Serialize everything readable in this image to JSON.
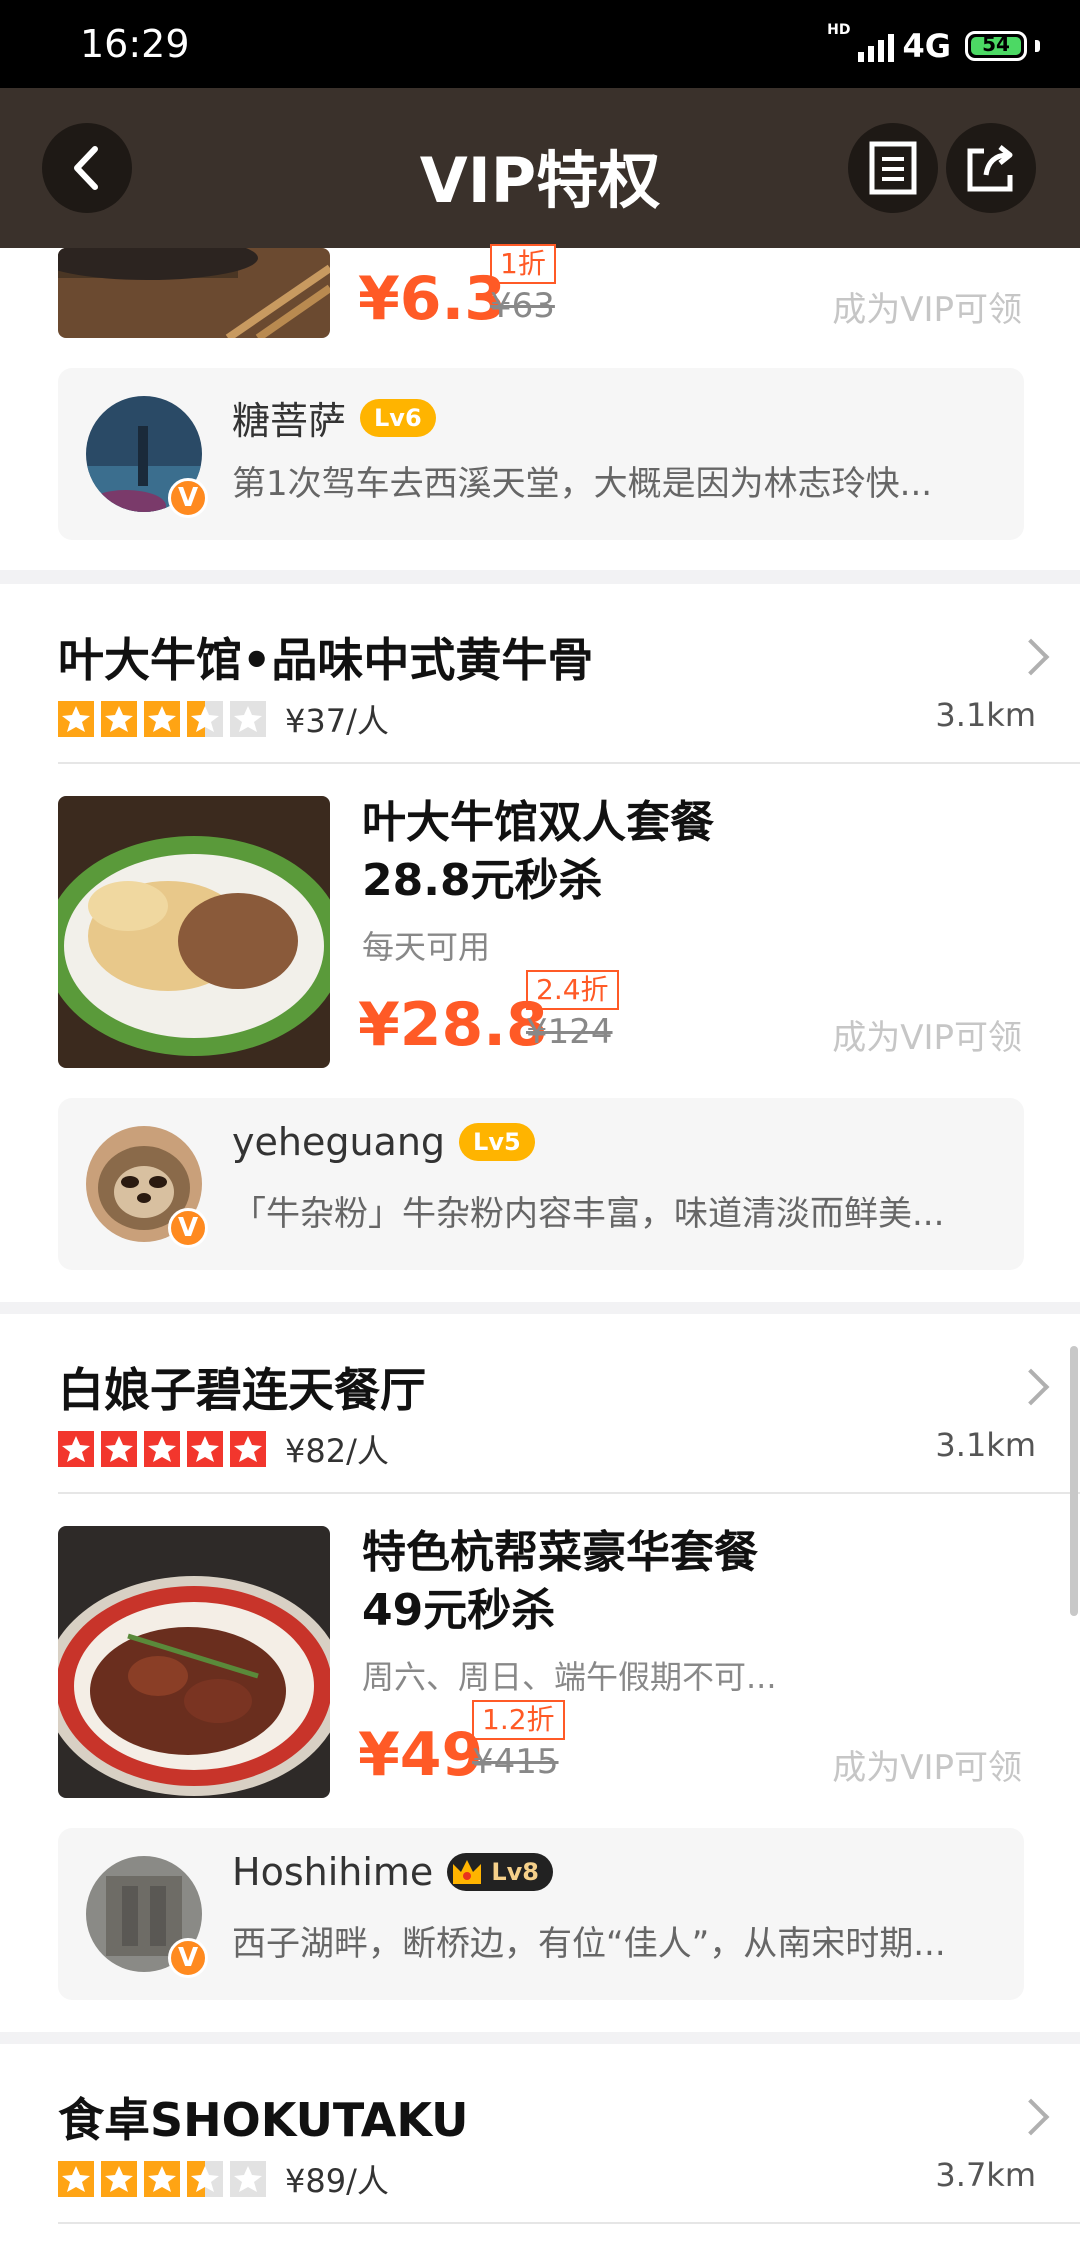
{
  "status": {
    "time": "16:29",
    "network": "4G",
    "hd": "HD",
    "battery": "54"
  },
  "header": {
    "title": "VIP特权"
  },
  "colors": {
    "accent": "#ff5a26",
    "header_bg": "#3a312b",
    "badge": "#ffb400"
  },
  "top_partial": {
    "price": "¥6.3",
    "original_price": "¥63",
    "discount": "1折",
    "claim": "成为VIP可领",
    "review": {
      "user": "糖菩萨",
      "level": "Lv6",
      "text": "第1次驾车去西溪天堂，大概是因为林志玲快..."
    }
  },
  "restaurants": [
    {
      "name": "叶大牛馆•品味中式黄牛骨",
      "rating": 3.5,
      "avg_price": "¥37/人",
      "distance": "3.1km",
      "deal": {
        "title_line1": "叶大牛馆双人套餐",
        "title_line2": "28.8元秒杀",
        "note": "每天可用",
        "price": "¥28.8",
        "original_price": "¥124",
        "discount": "2.4折",
        "claim": "成为VIP可领"
      },
      "review": {
        "user": "yeheguang",
        "level": "Lv5",
        "text": "「牛杂粉」牛杂粉内容丰富，味道清淡而鲜美..."
      }
    },
    {
      "name": "白娘子碧连天餐厅",
      "rating": 5,
      "avg_price": "¥82/人",
      "distance": "3.1km",
      "deal": {
        "title_line1": "特色杭帮菜豪华套餐",
        "title_line2": "49元秒杀",
        "note": "周六、周日、端午假期不可...",
        "price": "¥49",
        "original_price": "¥415",
        "discount": "1.2折",
        "claim": "成为VIP可领"
      },
      "review": {
        "user": "Hoshihime",
        "level": "Lv8",
        "text": "西子湖畔，断桥边，有位“佳人”，从南宋时期..."
      }
    },
    {
      "name": "食卓SHOKUTAKU",
      "rating": 3.5,
      "avg_price": "¥89/人",
      "distance": "3.7km"
    }
  ]
}
